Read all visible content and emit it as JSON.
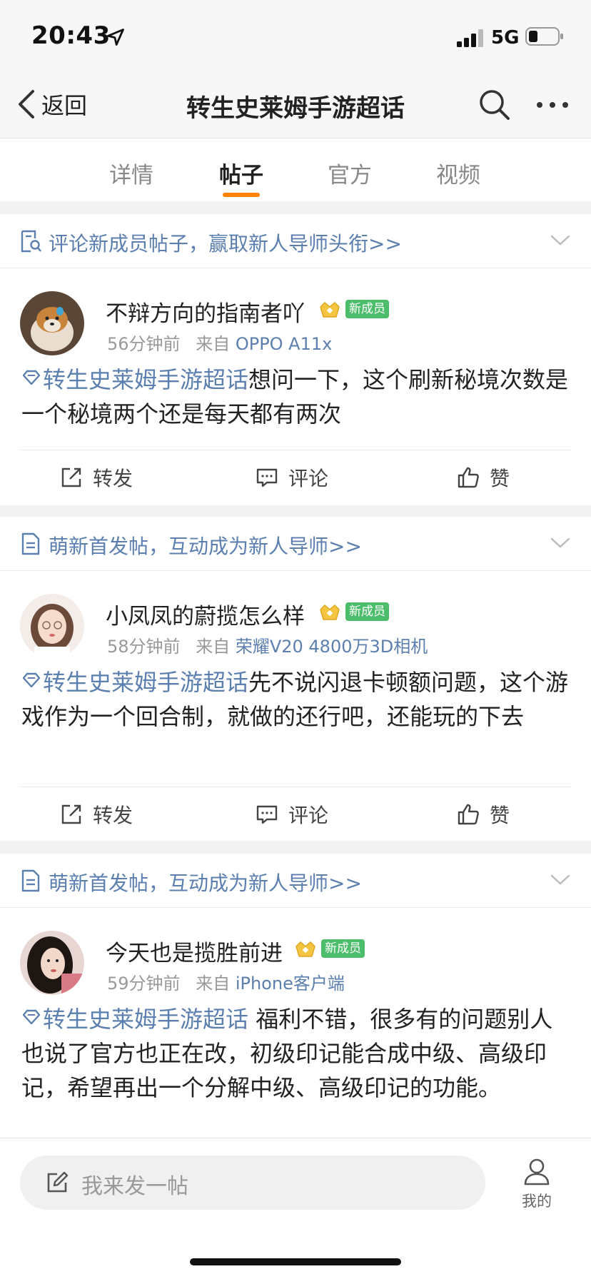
{
  "status": {
    "time": "20:43",
    "network": "5G"
  },
  "nav": {
    "back_label": "返回",
    "title": "转生史莱姆手游超话"
  },
  "tabs": [
    {
      "label": "详情",
      "active": false
    },
    {
      "label": "帖子",
      "active": true
    },
    {
      "label": "官方",
      "active": false
    },
    {
      "label": "视频",
      "active": false
    }
  ],
  "posts": [
    {
      "banner": "评论新成员帖子，赢取新人导师头衔>>",
      "user": "不辩方向的指南者吖",
      "badge": "新成员",
      "time": "56分钟前",
      "from_label": "来自",
      "source": "OPPO A11x",
      "topic": "转生史莱姆手游超话",
      "text": "想问一下，这个刷新秘境次数是一个秘境两个还是每天都有两次",
      "actions": {
        "repost": "转发",
        "comment": "评论",
        "like": "赞"
      }
    },
    {
      "banner": "萌新首发帖，互动成为新人导师>>",
      "user": "小凤凤的蔚揽怎么样",
      "badge": "新成员",
      "time": "58分钟前",
      "from_label": "来自",
      "source": "荣耀V20 4800万3D相机",
      "topic": "转生史莱姆手游超话",
      "text": "先不说闪退卡顿额问题，这个游戏作为一个回合制，就做的还行吧，还能玩的下去",
      "actions": {
        "repost": "转发",
        "comment": "评论",
        "like": "赞"
      }
    },
    {
      "banner": "萌新首发帖，互动成为新人导师>>",
      "user": "今天也是揽胜前进",
      "badge": "新成员",
      "time": "59分钟前",
      "from_label": "来自",
      "source": "iPhone客户端",
      "topic": "转生史莱姆手游超话",
      "text": " 福利不错，很多有的问题别人也说了官方也正在改，初级印记能合成中级、高级印记，希望再出一个分解中级、高级印记的功能。"
    }
  ],
  "bottom": {
    "compose_placeholder": "我来发一帖",
    "me_label": "我的"
  },
  "colors": {
    "accent": "#ff8200",
    "link": "#5b7fae",
    "badge": "#4cbd6a"
  }
}
